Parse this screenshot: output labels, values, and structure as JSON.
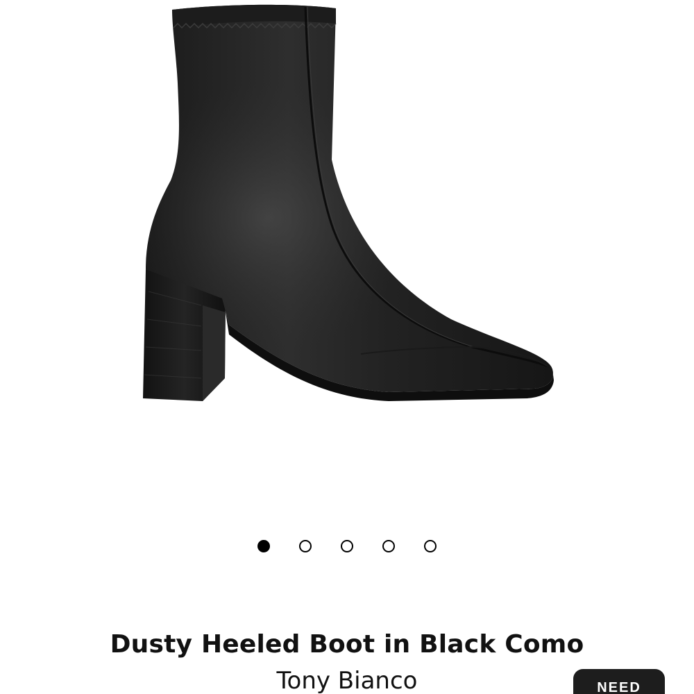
{
  "gallery": {
    "image_subject": "black leather heeled ankle boot",
    "image_icon": "boot-image",
    "slide_count": 5,
    "active_slide": 1,
    "colors": {
      "background": "#ffffff",
      "dot_active": "#000000",
      "dot_inactive": "#ffffff"
    }
  },
  "product": {
    "title": "Dusty Heeled Boot in Black Como",
    "brand": "Tony Bianco"
  },
  "floating_button": {
    "label": "NEED",
    "background": "#1d1d1d"
  }
}
